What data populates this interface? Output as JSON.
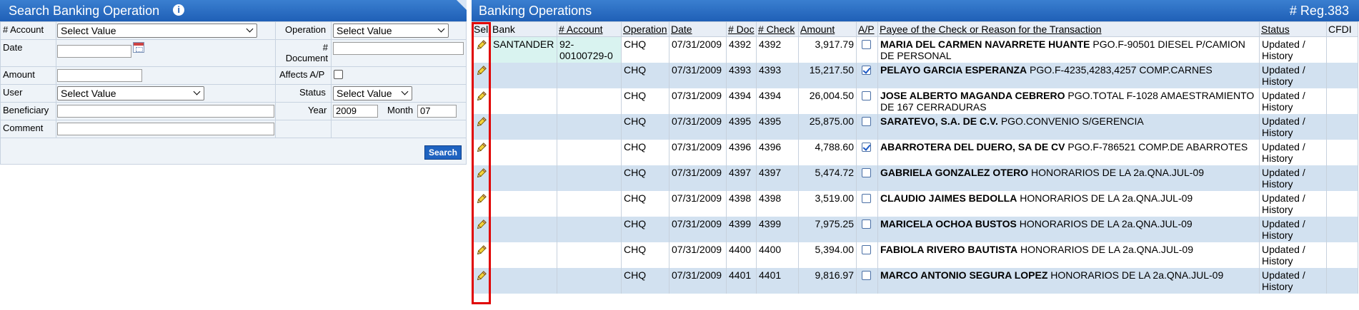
{
  "search": {
    "title": "Search Banking Operation",
    "info_icon": "i",
    "labels": {
      "account": "# Account",
      "operation": "Operation",
      "date": "Date",
      "document": "# Document",
      "amount": "Amount",
      "affects_ap": "Affects A/P",
      "user": "User",
      "status": "Status",
      "beneficiary": "Beneficiary",
      "year": "Year",
      "month": "Month",
      "comment": "Comment"
    },
    "account_select": "Select Value",
    "operation_select": "Select Value",
    "user_select": "Select Value",
    "status_select": "Select Value",
    "year_value": "2009",
    "month_value": "07",
    "search_button": "Search"
  },
  "ops": {
    "title": "Banking Operations",
    "reg_count": "# Reg.383",
    "columns": {
      "sel": "Sel",
      "bank": "Bank",
      "account": "# Account",
      "operation": "Operation",
      "date": "Date",
      "doc": "# Doc",
      "check": "# Check",
      "amount": "Amount",
      "ap": "A/P",
      "payee": "Payee of the Check or Reason for the Transaction",
      "status": "Status",
      "cfdi": "CFDI"
    },
    "rows": [
      {
        "bank": "SANTANDER",
        "account": "92-00100729-0",
        "operation": "CHQ",
        "date": "07/31/2009",
        "doc": "4392",
        "check": "4392",
        "amount": "3,917.79",
        "ap": false,
        "payee": "MARIA DEL CARMEN NAVARRETE HUANTE",
        "reason": "PGO.F-90501 DIESEL P/CAMION DE PERSONAL",
        "status": "Updated / History"
      },
      {
        "bank": "",
        "account": "",
        "operation": "CHQ",
        "date": "07/31/2009",
        "doc": "4393",
        "check": "4393",
        "amount": "15,217.50",
        "ap": true,
        "payee": "PELAYO GARCIA ESPERANZA",
        "reason": "PGO.F-4235,4283,4257 COMP.CARNES",
        "status": "Updated / History"
      },
      {
        "bank": "",
        "account": "",
        "operation": "CHQ",
        "date": "07/31/2009",
        "doc": "4394",
        "check": "4394",
        "amount": "26,004.50",
        "ap": false,
        "payee": "JOSE ALBERTO MAGANDA CEBRERO",
        "reason": "PGO.TOTAL F-1028 AMAESTRAMIENTO DE 167 CERRADURAS",
        "status": "Updated / History"
      },
      {
        "bank": "",
        "account": "",
        "operation": "CHQ",
        "date": "07/31/2009",
        "doc": "4395",
        "check": "4395",
        "amount": "25,875.00",
        "ap": false,
        "payee": "SARATEVO, S.A. DE C.V.",
        "reason": "PGO.CONVENIO S/GERENCIA",
        "status": "Updated / History"
      },
      {
        "bank": "",
        "account": "",
        "operation": "CHQ",
        "date": "07/31/2009",
        "doc": "4396",
        "check": "4396",
        "amount": "4,788.60",
        "ap": true,
        "payee": "ABARROTERA DEL DUERO, SA DE CV",
        "reason": "PGO.F-786521 COMP.DE ABARROTES",
        "status": "Updated / History"
      },
      {
        "bank": "",
        "account": "",
        "operation": "CHQ",
        "date": "07/31/2009",
        "doc": "4397",
        "check": "4397",
        "amount": "5,474.72",
        "ap": false,
        "payee": "GABRIELA GONZALEZ OTERO",
        "reason": "HONORARIOS DE LA 2a.QNA.JUL-09",
        "status": "Updated / History"
      },
      {
        "bank": "",
        "account": "",
        "operation": "CHQ",
        "date": "07/31/2009",
        "doc": "4398",
        "check": "4398",
        "amount": "3,519.00",
        "ap": false,
        "payee": "CLAUDIO JAIMES BEDOLLA",
        "reason": "HONORARIOS DE LA 2a.QNA.JUL-09",
        "status": "Updated / History"
      },
      {
        "bank": "",
        "account": "",
        "operation": "CHQ",
        "date": "07/31/2009",
        "doc": "4399",
        "check": "4399",
        "amount": "7,975.25",
        "ap": false,
        "payee": "MARICELA OCHOA BUSTOS",
        "reason": "HONORARIOS DE LA 2a.QNA.JUL-09",
        "status": "Updated / History"
      },
      {
        "bank": "",
        "account": "",
        "operation": "CHQ",
        "date": "07/31/2009",
        "doc": "4400",
        "check": "4400",
        "amount": "5,394.00",
        "ap": false,
        "payee": "FABIOLA RIVERO BAUTISTA",
        "reason": "HONORARIOS DE LA 2a.QNA.JUL-09",
        "status": "Updated / History"
      },
      {
        "bank": "",
        "account": "",
        "operation": "CHQ",
        "date": "07/31/2009",
        "doc": "4401",
        "check": "4401",
        "amount": "9,816.97",
        "ap": false,
        "payee": "MARCO ANTONIO SEGURA LOPEZ",
        "reason": "HONORARIOS DE LA 2a.QNA.JUL-09",
        "status": "Updated / History"
      }
    ]
  },
  "colors": {
    "header_blue": "#1f5fb6",
    "row_alt": "#d2e1f0",
    "highlight_red": "#e00000",
    "account_cell": "#d9f3f0"
  },
  "icons": {
    "edit": "pencil-icon",
    "info": "info-icon",
    "calendar": "calendar-icon"
  }
}
